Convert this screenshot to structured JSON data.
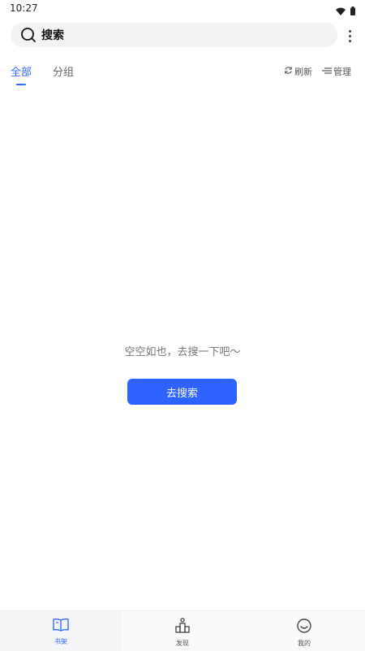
{
  "status_bar": {
    "time": "10:27",
    "icons": [
      "wifi-icon",
      "battery-icon"
    ]
  },
  "search": {
    "label": "搜索",
    "icon": "search-icon"
  },
  "menu": {
    "icon": "more-vert-icon"
  },
  "tabs": [
    {
      "label": "全部",
      "active": true
    },
    {
      "label": "分组",
      "active": false
    }
  ],
  "actions": {
    "refresh": {
      "label": "刷新",
      "icon": "refresh-icon"
    },
    "manage": {
      "label": "管理",
      "icon": "manage-icon"
    }
  },
  "empty_state": {
    "message": "空空如也，去搜一下吧～",
    "button_label": "去搜索"
  },
  "bottom_nav": [
    {
      "label": "书架",
      "icon": "book-icon",
      "active": true
    },
    {
      "label": "发现",
      "icon": "discover-icon",
      "active": false
    },
    {
      "label": "我的",
      "icon": "smile-icon",
      "active": false
    }
  ],
  "colors": {
    "accent": "#2f6bff",
    "button": "#2f63ff"
  }
}
